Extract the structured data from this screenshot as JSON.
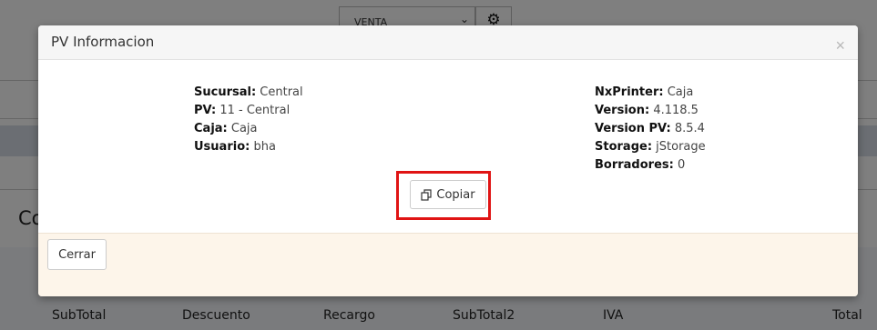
{
  "background": {
    "sale_type_select": "VENTA",
    "section_heading_partial": "Co",
    "totals_headers": [
      "SubTotal",
      "Descuento",
      "Recargo",
      "SubTotal2",
      "IVA",
      "Total"
    ]
  },
  "modal": {
    "title": "PV Informacion",
    "close_symbol": "×",
    "left_info": [
      {
        "label": "Sucursal:",
        "value": "Central"
      },
      {
        "label": "PV:",
        "value": "11 - Central"
      },
      {
        "label": "Caja:",
        "value": "Caja"
      },
      {
        "label": "Usuario:",
        "value": "bha"
      }
    ],
    "right_info": [
      {
        "label": "NxPrinter:",
        "value": "Caja"
      },
      {
        "label": "Version:",
        "value": "4.118.5"
      },
      {
        "label": "Version PV:",
        "value": "8.5.4"
      },
      {
        "label": "Storage:",
        "value": "jStorage"
      },
      {
        "label": "Borradores:",
        "value": "0"
      }
    ],
    "copy_button": {
      "label": "Copiar",
      "icon": "copy-icon"
    },
    "footer": {
      "close_button_label": "Cerrar"
    }
  },
  "colors": {
    "highlight": "#e01414",
    "footer_background": "#fdf5ea",
    "header_background": "#f6f6f6"
  }
}
